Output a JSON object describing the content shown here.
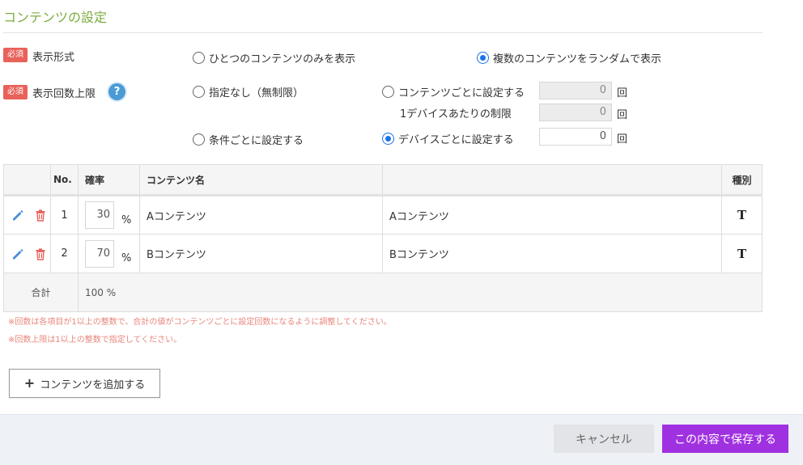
{
  "page": {
    "title": "コンテンツの設定"
  },
  "display_format": {
    "required_badge": "必須",
    "label": "表示形式",
    "options": [
      {
        "label": "ひとつのコンテンツのみを表示",
        "selected": false
      },
      {
        "label": "複数のコンテンツをランダムで表示",
        "selected": true
      }
    ]
  },
  "display_limit": {
    "required_badge": "必須",
    "label": "表示回数上限",
    "help": "?",
    "unlimited_label": "指定なし（無制限）",
    "per_condition_label": "条件ごとに設定する",
    "per_content_label": "コンテンツごとに設定する",
    "per_content_value": "0",
    "per_device_sub_label": "1デバイスあたりの制限",
    "per_device_sub_value": "0",
    "per_device_label": "デバイスごとに設定する",
    "per_device_value": "0",
    "unit": "回",
    "selected_left": "unlimited",
    "selected_right": "per_device"
  },
  "table": {
    "headers": {
      "actions": "",
      "no": "No.",
      "rate": "確率",
      "name": "コンテンツ名",
      "detail": "",
      "type": "種別"
    },
    "rows": [
      {
        "no": "1",
        "rate": "30",
        "unit": "%",
        "name": "Aコンテンツ",
        "detail": "Aコンテンツ",
        "type": "T"
      },
      {
        "no": "2",
        "rate": "70",
        "unit": "%",
        "name": "Bコンテンツ",
        "detail": "Bコンテンツ",
        "type": "T"
      }
    ],
    "total_label": "合計",
    "total_value": "100 %"
  },
  "notes": [
    "※回数は各項目が1以上の整数で、合計の値がコンテンツごとに設定回数になるように調整してください。",
    "※回数上限は1以上の整数で指定してください。"
  ],
  "add_button": {
    "label": "コンテンツを追加する"
  },
  "footer": {
    "cancel": "キャンセル",
    "save": "この内容で保存する"
  },
  "colors": {
    "title": "#7cab3c",
    "badge": "#e8625a",
    "radio": "#1a73e8",
    "save": "#a031e0",
    "note": "#e8857b",
    "edit_icon": "#4a8fd6",
    "delete_icon": "#e8625a"
  }
}
